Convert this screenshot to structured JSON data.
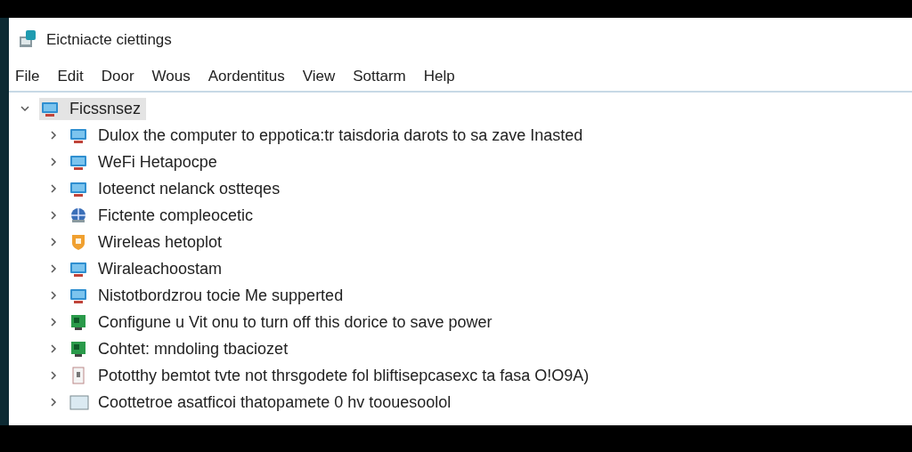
{
  "window": {
    "title": "Eictniacte ciettings"
  },
  "menu": [
    "File",
    "Edit",
    "Door",
    "Wous",
    "Aordentitus",
    "View",
    "Sottarm",
    "Help"
  ],
  "tree": [
    {
      "label": "Ficssnsez",
      "kind": "network",
      "expanded": true,
      "selected": true,
      "children": [
        {
          "label": "Dulox the computer to eppotica:tr taisdoria darots to sa zave Inasted",
          "kind": "network",
          "expanded": false,
          "selected": false
        },
        {
          "label": "WeFi Hetapocpe",
          "kind": "network",
          "expanded": false,
          "selected": false
        },
        {
          "label": "Ioteenct nelanck ostteqes",
          "kind": "network",
          "expanded": false,
          "selected": false
        },
        {
          "label": "Fictente compleocetic",
          "kind": "globe",
          "expanded": false,
          "selected": false
        },
        {
          "label": "Wireleas hetoplot",
          "kind": "shield",
          "expanded": false,
          "selected": false
        },
        {
          "label": "Wiraleachoostam",
          "kind": "network",
          "expanded": false,
          "selected": false
        },
        {
          "label": "Nistotbordzrou tocie Me supperted",
          "kind": "network",
          "expanded": false,
          "selected": false
        },
        {
          "label": "Configune u Vit onu to turn off this dorice to save power",
          "kind": "board",
          "expanded": false,
          "selected": false
        },
        {
          "label": "Cohtet: mndoling tbaciozet",
          "kind": "board",
          "expanded": false,
          "selected": false
        },
        {
          "label": "Pototthy bemtot tvte not thrsgodete fol bliftisepcasexc ta fasa O!O9A)",
          "kind": "card",
          "expanded": false,
          "selected": false
        },
        {
          "label": "Coottetroe asatficoi thatopamete 0 hv toouesoolol",
          "kind": "panel",
          "expanded": false,
          "selected": false
        }
      ]
    }
  ]
}
